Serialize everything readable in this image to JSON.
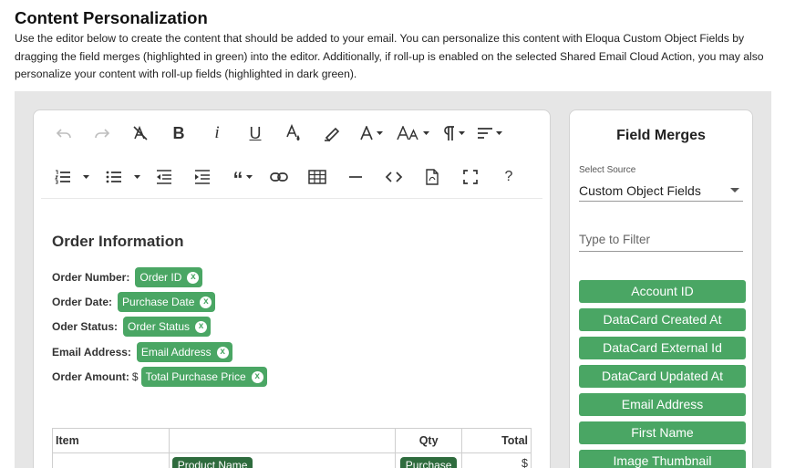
{
  "page": {
    "title": "Content Personalization",
    "description": "Use the editor below to create the content that should be added to your email. You can personalize this content with Eloqua Custom Object Fields by dragging the field merges (highlighted in green) into the editor. Additionally, if roll-up is enabled on the selected Shared Email Cloud Action, you may also personalize your content with roll-up fields (highlighted in dark green)."
  },
  "toolbar": {
    "bold": "B",
    "italic": "i",
    "underline": "U",
    "help": "?"
  },
  "editor": {
    "heading": "Order Information",
    "fields": [
      {
        "label": "Order Number:",
        "prefix": "",
        "tag": "Order ID"
      },
      {
        "label": "Order Date:",
        "prefix": "",
        "tag": "Purchase Date"
      },
      {
        "label": "Oder Status:",
        "prefix": "",
        "tag": "Order Status"
      },
      {
        "label": "Email Address:",
        "prefix": "",
        "tag": "Email Address"
      },
      {
        "label": "Order Amount:",
        "prefix": "$",
        "tag": "Total Purchase Price"
      }
    ],
    "remove_glyph": "x",
    "table": {
      "headers": [
        "Item",
        "",
        "Qty",
        "Total"
      ],
      "row": {
        "name_tag": "Product Name",
        "qty_tag": "Purchase",
        "total": "$"
      }
    }
  },
  "panel": {
    "title": "Field Merges",
    "source_label": "Select Source",
    "source_value": "Custom Object Fields",
    "filter_placeholder": "Type to Filter",
    "merges": [
      "Account ID",
      "DataCard Created At",
      "DataCard External Id",
      "DataCard Updated At",
      "Email Address",
      "First Name",
      "Image Thumbnail"
    ]
  },
  "colors": {
    "merge_green": "#4aa664",
    "rollup_dark_green": "#2e6b3d",
    "panel_bg": "#e6e6e6"
  }
}
